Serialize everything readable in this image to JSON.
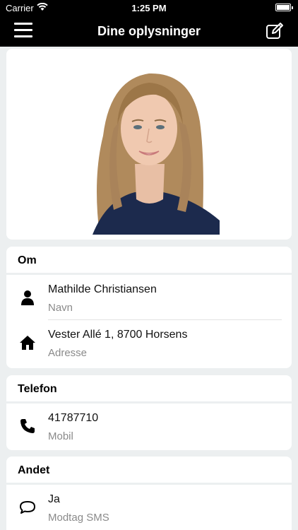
{
  "status_bar": {
    "carrier": "Carrier",
    "time": "1:25 PM"
  },
  "navbar": {
    "title": "Dine oplysninger"
  },
  "sections": {
    "om": {
      "header": "Om",
      "rows": [
        {
          "value": "Mathilde Christiansen",
          "label": "Navn",
          "icon": "person-icon"
        },
        {
          "value": "Vester Allé 1, 8700 Horsens",
          "label": "Adresse",
          "icon": "home-icon"
        }
      ]
    },
    "telefon": {
      "header": "Telefon",
      "rows": [
        {
          "value": "41787710",
          "label": "Mobil",
          "icon": "phone-icon"
        }
      ]
    },
    "andet": {
      "header": "Andet",
      "rows": [
        {
          "value": "Ja",
          "label": "Modtag SMS",
          "icon": "chat-bubble-icon"
        }
      ]
    }
  },
  "colors": {
    "bar": "#000000",
    "background": "#eceff0",
    "card": "#ffffff",
    "label": "#8a8a8a"
  }
}
